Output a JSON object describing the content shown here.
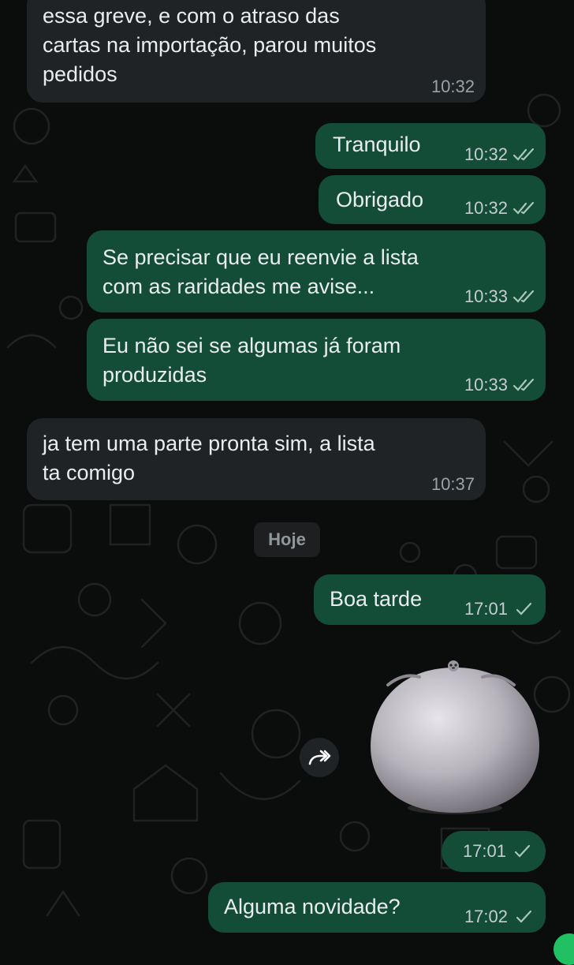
{
  "colors": {
    "incoming_bubble": "#1f2325",
    "outgoing_bubble": "#134d37",
    "read_ticks": "#a7c7b9",
    "background": "#0b0c0c"
  },
  "messages": [
    {
      "direction": "in",
      "text": "essa greve, e com o atraso das\ncartas na importação, parou muitos\npedidos",
      "time": "10:32"
    },
    {
      "direction": "out",
      "text": "Tranquilo",
      "time": "10:32",
      "status": "read"
    },
    {
      "direction": "out",
      "text": "Obrigado",
      "time": "10:32",
      "status": "read"
    },
    {
      "direction": "out",
      "text": "Se precisar que eu reenvie a lista\ncom as raridades me avise...",
      "time": "10:33",
      "status": "read"
    },
    {
      "direction": "out",
      "text": "Eu não sei se algumas já foram\nproduzidas",
      "time": "10:33",
      "status": "read"
    },
    {
      "direction": "in",
      "text": "ja tem uma parte pronta sim, a lista\nta comigo",
      "time": "10:37"
    },
    {
      "direction": "out",
      "text": "Boa tarde",
      "time": "17:01",
      "status": "sent"
    },
    {
      "direction": "out",
      "type": "sticker",
      "sticker": "round-seal-sticker",
      "time": "17:01",
      "status": "sent"
    },
    {
      "direction": "out",
      "text": "Alguma novidade?",
      "time": "17:02",
      "status": "sent"
    }
  ],
  "date_separator": "Hoje",
  "icons": {
    "forward": "forward-arrow-icon",
    "read": "double-check-icon",
    "sent": "single-check-icon"
  }
}
